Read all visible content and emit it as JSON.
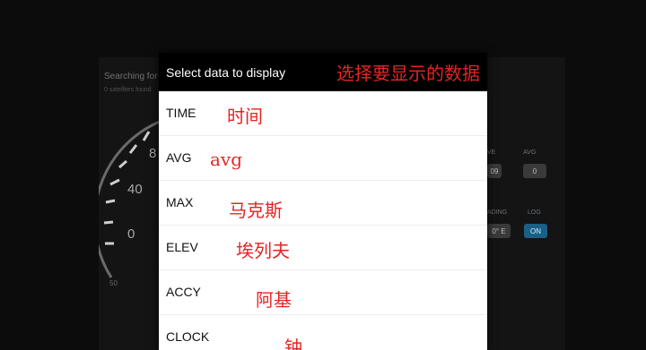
{
  "background": {
    "searching_text": "Searching for",
    "satellites_text": "0 satellites found",
    "gauge_ticks": [
      "8",
      "40",
      "0",
      "50"
    ],
    "stats": [
      {
        "label": "VE",
        "value": "09"
      },
      {
        "label": "AVG",
        "value": "0"
      },
      {
        "label": "ADING",
        "value": "0° E"
      },
      {
        "label": "LOG",
        "value": "ON"
      }
    ],
    "accent_color": "#1b5f86"
  },
  "dialog": {
    "title": "Select data to display",
    "title_note": "选择要显示的数据",
    "note_color": "#e52424",
    "items": [
      {
        "label": "TIME",
        "note": "时间"
      },
      {
        "label": "AVG",
        "note": "avg"
      },
      {
        "label": "MAX",
        "note": "马克斯"
      },
      {
        "label": "ELEV",
        "note": "埃列夫"
      },
      {
        "label": "ACCY",
        "note": "阿基"
      },
      {
        "label": "CLOCK",
        "note": "钟"
      }
    ]
  }
}
